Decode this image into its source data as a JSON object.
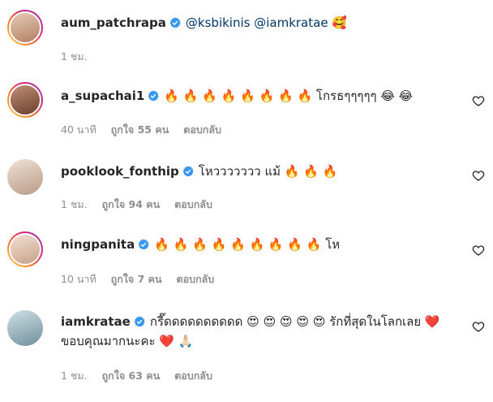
{
  "comments": [
    {
      "username": "aum_patchrapa",
      "text": "@ksbikinis @iamkratae 🥰",
      "time": "1 ชม.",
      "likes": "",
      "reply": "",
      "avatar_color": "#c9a38a"
    },
    {
      "username": "a_supachai1",
      "text": "🔥 🔥 🔥 🔥 🔥 🔥 🔥 🔥 โกรธๆๆๆๆๆ 😂 😂",
      "time": "40 นาที",
      "likes": "ถูกใจ 55 คน",
      "reply": "ตอบกลับ",
      "avatar_color": "#8a5a45"
    },
    {
      "username": "pooklook_fonthip",
      "text": "โหววววววว แม้ 🔥 🔥 🔥",
      "time": "1 ชม.",
      "likes": "ถูกใจ 94 คน",
      "reply": "ตอบกลับ",
      "avatar_color": "#d8c2b2"
    },
    {
      "username": "ningpanita",
      "text": "🔥 🔥 🔥 🔥 🔥 🔥 🔥 🔥 🔥 โห",
      "time": "10 นาที",
      "likes": "ถูกใจ 7 คน",
      "reply": "ตอบกลับ",
      "avatar_color": "#e3c7b4"
    },
    {
      "username": "iamkratae",
      "text": "กรี๊ดดดดดดดดดด 😍 😍 😍 😍 😍 รักที่สุดในโลกเลย ❤️ ขอบคุณมากนะคะ ❤️ 🙏🏻",
      "time": "1 ชม.",
      "likes": "ถูกใจ 63 คน",
      "reply": "ตอบกลับ",
      "avatar_color": "#8fb3c0"
    }
  ],
  "icons": {
    "verified": "verified-badge-icon",
    "like": "heart-outline-icon"
  },
  "colors": {
    "verified": "#3897f0",
    "meta": "#8e8e8e",
    "mention": "#00376b"
  }
}
